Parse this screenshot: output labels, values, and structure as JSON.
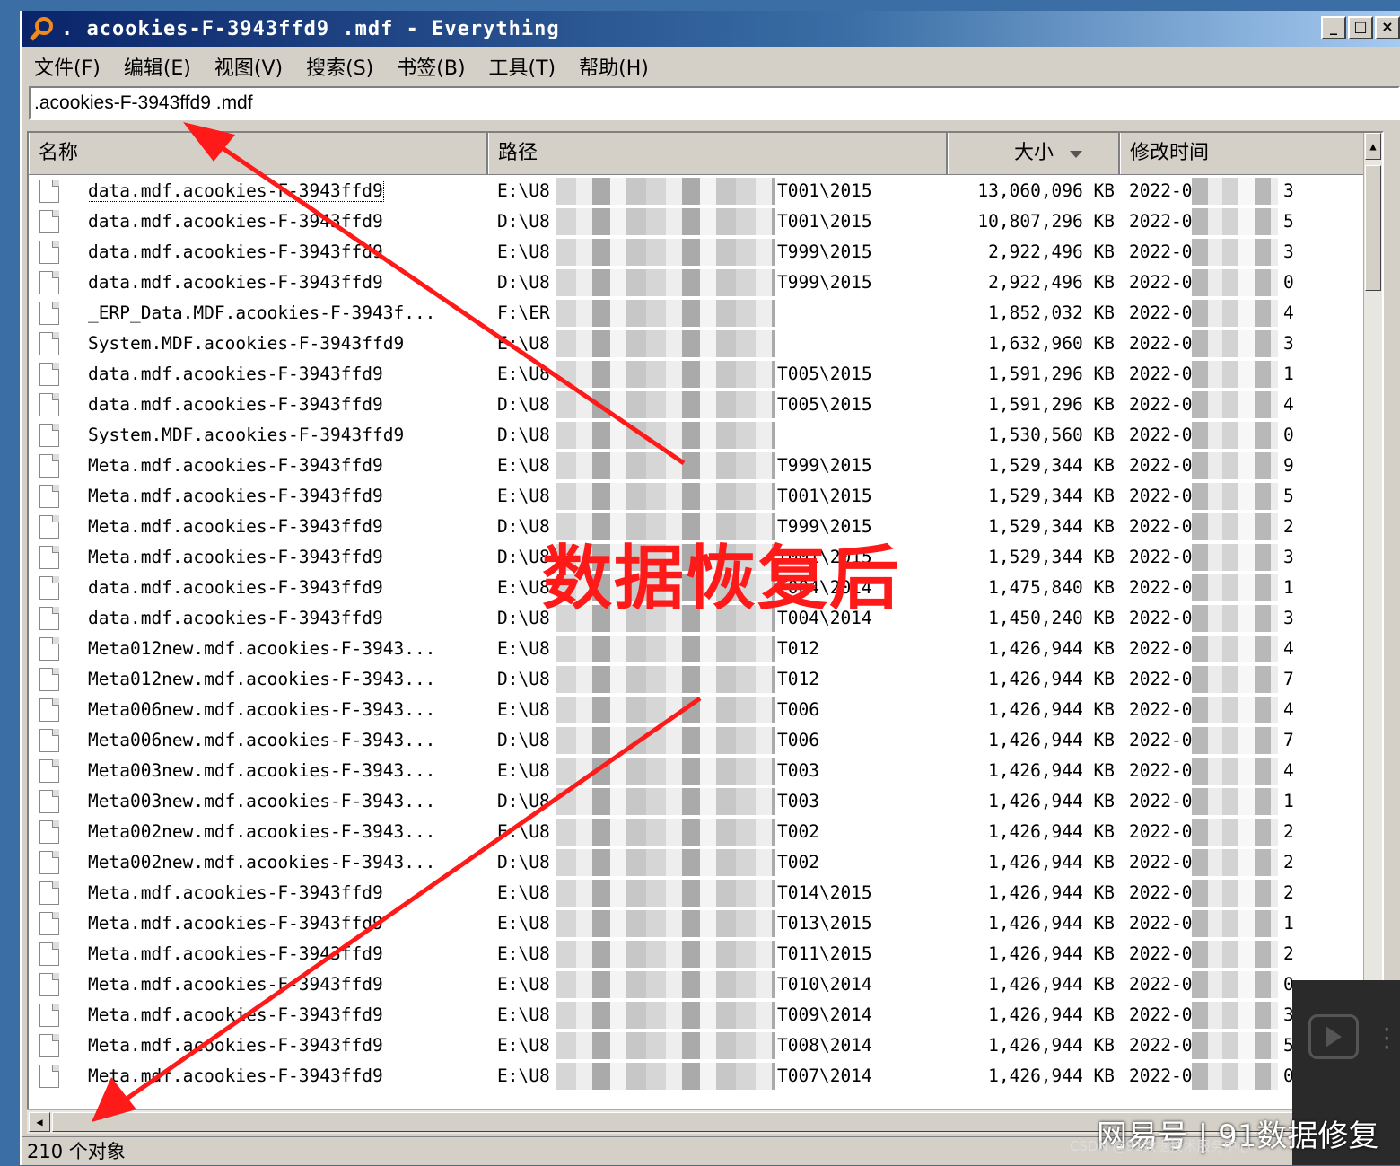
{
  "window": {
    "title": ". acookies-F-3943ffd9 .mdf - Everything",
    "buttons": [
      "_",
      "□",
      "×"
    ]
  },
  "menu": [
    "文件(F)",
    "编辑(E)",
    "视图(V)",
    "搜索(S)",
    "书签(B)",
    "工具(T)",
    "帮助(H)"
  ],
  "search": {
    "value": ".acookies-F-3943ffd9 .mdf"
  },
  "columns": {
    "name": "名称",
    "path": "路径",
    "size": "大小",
    "modified": "修改时间"
  },
  "rows": [
    {
      "name": "data.mdf.acookies-F-3943ffd9",
      "drive": "E:\\U8",
      "path": "T001\\2015",
      "size": "13,060,096 KB",
      "date": "2022-0",
      "tail": "3"
    },
    {
      "name": "data.mdf.acookies-F-3943ffd9",
      "drive": "D:\\U8",
      "path": "T001\\2015",
      "size": "10,807,296 KB",
      "date": "2022-0",
      "tail": "5"
    },
    {
      "name": "data.mdf.acookies-F-3943ffd9",
      "drive": "E:\\U8",
      "path": "T999\\2015",
      "size": "2,922,496 KB",
      "date": "2022-0",
      "tail": "3"
    },
    {
      "name": "data.mdf.acookies-F-3943ffd9",
      "drive": "D:\\U8",
      "path": "T999\\2015",
      "size": "2,922,496 KB",
      "date": "2022-0",
      "tail": "0"
    },
    {
      "name": "_ERP_Data.MDF.acookies-F-3943f...",
      "drive": "F:\\ER",
      "path": "",
      "size": "1,852,032 KB",
      "date": "2022-0",
      "tail": "4"
    },
    {
      "name": "System.MDF.acookies-F-3943ffd9",
      "drive": "E:\\U8",
      "path": "",
      "size": "1,632,960 KB",
      "date": "2022-0",
      "tail": "3"
    },
    {
      "name": "data.mdf.acookies-F-3943ffd9",
      "drive": "E:\\U8",
      "path": "T005\\2015",
      "size": "1,591,296 KB",
      "date": "2022-0",
      "tail": "1"
    },
    {
      "name": "data.mdf.acookies-F-3943ffd9",
      "drive": "D:\\U8",
      "path": "T005\\2015",
      "size": "1,591,296 KB",
      "date": "2022-0",
      "tail": "4"
    },
    {
      "name": "System.MDF.acookies-F-3943ffd9",
      "drive": "D:\\U8",
      "path": "",
      "size": "1,530,560 KB",
      "date": "2022-0",
      "tail": "0"
    },
    {
      "name": "Meta.mdf.acookies-F-3943ffd9",
      "drive": "E:\\U8",
      "path": "T999\\2015",
      "size": "1,529,344 KB",
      "date": "2022-0",
      "tail": "9"
    },
    {
      "name": "Meta.mdf.acookies-F-3943ffd9",
      "drive": "E:\\U8",
      "path": "T001\\2015",
      "size": "1,529,344 KB",
      "date": "2022-0",
      "tail": "5"
    },
    {
      "name": "Meta.mdf.acookies-F-3943ffd9",
      "drive": "D:\\U8",
      "path": "T999\\2015",
      "size": "1,529,344 KB",
      "date": "2022-0",
      "tail": "2"
    },
    {
      "name": "Meta.mdf.acookies-F-3943ffd9",
      "drive": "D:\\U8",
      "path": "T001\\2015",
      "size": "1,529,344 KB",
      "date": "2022-0",
      "tail": "3"
    },
    {
      "name": "data.mdf.acookies-F-3943ffd9",
      "drive": "E:\\U8",
      "path": "T004\\2014",
      "size": "1,475,840 KB",
      "date": "2022-0",
      "tail": "1"
    },
    {
      "name": "data.mdf.acookies-F-3943ffd9",
      "drive": "D:\\U8",
      "path": "T004\\2014",
      "size": "1,450,240 KB",
      "date": "2022-0",
      "tail": "3"
    },
    {
      "name": "Meta012new.mdf.acookies-F-3943...",
      "drive": "E:\\U8",
      "path": "T012",
      "size": "1,426,944 KB",
      "date": "2022-0",
      "tail": "4"
    },
    {
      "name": "Meta012new.mdf.acookies-F-3943...",
      "drive": "D:\\U8",
      "path": "T012",
      "size": "1,426,944 KB",
      "date": "2022-0",
      "tail": "7"
    },
    {
      "name": "Meta006new.mdf.acookies-F-3943...",
      "drive": "E:\\U8",
      "path": "T006",
      "size": "1,426,944 KB",
      "date": "2022-0",
      "tail": "4"
    },
    {
      "name": "Meta006new.mdf.acookies-F-3943...",
      "drive": "D:\\U8",
      "path": "T006",
      "size": "1,426,944 KB",
      "date": "2022-0",
      "tail": "7"
    },
    {
      "name": "Meta003new.mdf.acookies-F-3943...",
      "drive": "E:\\U8",
      "path": "T003",
      "size": "1,426,944 KB",
      "date": "2022-0",
      "tail": "4"
    },
    {
      "name": "Meta003new.mdf.acookies-F-3943...",
      "drive": "D:\\U8",
      "path": "T003",
      "size": "1,426,944 KB",
      "date": "2022-0",
      "tail": "1"
    },
    {
      "name": "Meta002new.mdf.acookies-F-3943...",
      "drive": "E:\\U8",
      "path": "T002",
      "size": "1,426,944 KB",
      "date": "2022-0",
      "tail": "2"
    },
    {
      "name": "Meta002new.mdf.acookies-F-3943...",
      "drive": "D:\\U8",
      "path": "T002",
      "size": "1,426,944 KB",
      "date": "2022-0",
      "tail": "2"
    },
    {
      "name": "Meta.mdf.acookies-F-3943ffd9",
      "drive": "E:\\U8",
      "path": "T014\\2015",
      "size": "1,426,944 KB",
      "date": "2022-0",
      "tail": "2"
    },
    {
      "name": "Meta.mdf.acookies-F-3943ffd9",
      "drive": "E:\\U8",
      "path": "T013\\2015",
      "size": "1,426,944 KB",
      "date": "2022-0",
      "tail": "1"
    },
    {
      "name": "Meta.mdf.acookies-F-3943ffd9",
      "drive": "E:\\U8",
      "path": "T011\\2015",
      "size": "1,426,944 KB",
      "date": "2022-0",
      "tail": "2"
    },
    {
      "name": "Meta.mdf.acookies-F-3943ffd9",
      "drive": "E:\\U8",
      "path": "T010\\2014",
      "size": "1,426,944 KB",
      "date": "2022-0",
      "tail": "0"
    },
    {
      "name": "Meta.mdf.acookies-F-3943ffd9",
      "drive": "E:\\U8",
      "path": "T009\\2014",
      "size": "1,426,944 KB",
      "date": "2022-0",
      "tail": "3"
    },
    {
      "name": "Meta.mdf.acookies-F-3943ffd9",
      "drive": "E:\\U8",
      "path": "T008\\2014",
      "size": "1,426,944 KB",
      "date": "2022-0",
      "tail": "5"
    },
    {
      "name": "Meta.mdf.acookies-F-3943ffd9",
      "drive": "E:\\U8",
      "path": "T007\\2014",
      "size": "1,426,944 KB",
      "date": "2022-0",
      "tail": "0"
    }
  ],
  "status": "210 个对象",
  "annotation": {
    "text": "数据恢复后",
    "color": "#ff1a1a"
  },
  "watermark": {
    "main": "网易号 | 91数据修复",
    "small": "CSDN @91数据技术服务中心"
  }
}
